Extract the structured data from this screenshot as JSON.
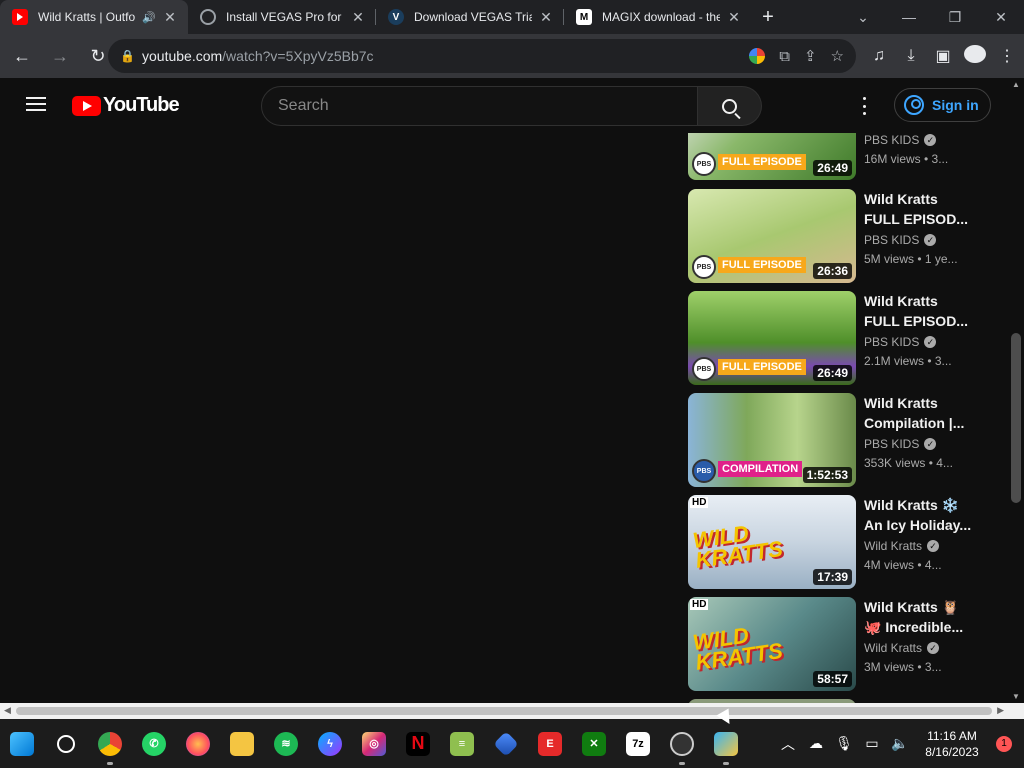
{
  "browser": {
    "tabs": [
      {
        "title": "Wild Kratts | Outfo",
        "favicon": "youtube-icon",
        "favicon_color": "#ff0000",
        "audio": true,
        "active": true
      },
      {
        "title": "Install VEGAS Pro for fr",
        "favicon": "globe-icon",
        "favicon_color": "#9aa0a6"
      },
      {
        "title": "Download VEGAS Trial",
        "favicon": "vegas-icon",
        "favicon_color": "#1a3d5c"
      },
      {
        "title": "MAGIX download - the",
        "favicon": "magix-icon",
        "favicon_color": "#ffffff"
      }
    ],
    "new_tab_label": "+",
    "url_host": "youtube.com",
    "url_path": "/watch?v=5XpyVz5Bb7c"
  },
  "youtube": {
    "logo_text": "YouTube",
    "search_placeholder": "Search",
    "signin_label": "Sign in",
    "videos": [
      {
        "title": "",
        "channel": "PBS KIDS",
        "stats": "16M views  • 3...",
        "duration": "26:49",
        "tag": "FULL EPISODE",
        "thumb_color": "#6a9a3c"
      },
      {
        "title": "Wild Kratts FULL EPISOD...",
        "channel": "PBS KIDS",
        "stats": "5M views  • 1 ye...",
        "duration": "26:36",
        "tag": "FULL EPISODE",
        "thumb_color": "#bcd48a"
      },
      {
        "title": "Wild Kratts FULL EPISOD...",
        "channel": "PBS KIDS",
        "stats": "2.1M views  • 3...",
        "duration": "26:49",
        "tag": "FULL EPISODE",
        "thumb_color": "#4f8f2a"
      },
      {
        "title": "Wild Kratts Compilation |...",
        "channel": "PBS KIDS",
        "stats": "353K views  • 4...",
        "duration": "1:52:53",
        "tag": "COMPILATION",
        "thumb_color": "#7fa85a"
      },
      {
        "title": "Wild Kratts ❄️ An Icy Holiday...",
        "channel": "Wild Kratts",
        "stats": "4M views  • 4...",
        "duration": "17:39",
        "tag": "",
        "hd": "HD",
        "thumb_color": "#dfe6ee"
      },
      {
        "title": "Wild Kratts 🦉 🐙 Incredible...",
        "channel": "Wild Kratts",
        "stats": "3M views  • 3...",
        "duration": "58:57",
        "tag": "",
        "hd": "HD",
        "thumb_color": "#5a8a8a"
      }
    ]
  },
  "taskbar": {
    "apps": [
      "windows-start-icon",
      "search-icon",
      "chrome-icon",
      "whatsapp-icon",
      "firefox-icon",
      "file-explorer-icon",
      "spotify-icon",
      "messenger-icon",
      "instagram-icon",
      "netflix-icon",
      "notepad-icon",
      "app-icon",
      "epic-icon",
      "xbox-icon",
      "7zip-icon",
      "obs-icon",
      "snipping-icon"
    ],
    "time": "11:16 AM",
    "date": "8/16/2023",
    "notification_count": "1"
  }
}
